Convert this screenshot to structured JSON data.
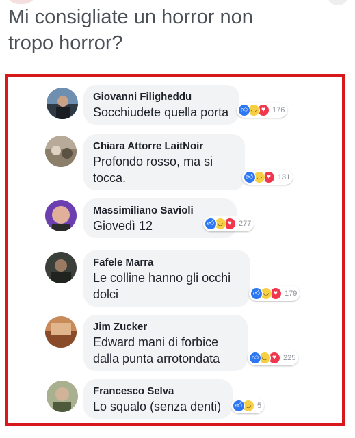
{
  "post": {
    "line1": "Mi consigliate un horror non",
    "line2": "tropo horror?"
  },
  "colors": {
    "highlight_border": "#d7191c",
    "bubble_bg": "#f2f3f5",
    "like": "#2d77f2",
    "haha": "#f7cf45",
    "love": "#f0374e"
  },
  "comments": [
    {
      "author": "Giovanni Filigheddu",
      "lines": [
        "Socchiudete quella porta"
      ],
      "reactions": [
        "like-icon",
        "haha-icon",
        "love-icon"
      ],
      "count": "176"
    },
    {
      "author": "Chiara Attorre LaitNoir",
      "lines": [
        "Profondo rosso, ma si",
        "tocca."
      ],
      "reactions": [
        "like-icon",
        "haha-icon",
        "love-icon"
      ],
      "count": "131"
    },
    {
      "author": "Massimiliano Savioli",
      "lines": [
        "Giovedì 12"
      ],
      "reactions": [
        "like-icon",
        "haha-icon",
        "love-icon"
      ],
      "count": "277"
    },
    {
      "author": "Fafele Marra",
      "lines": [
        "Le colline hanno gli occhi",
        "dolci"
      ],
      "reactions": [
        "like-icon",
        "haha-icon",
        "love-icon"
      ],
      "count": "179"
    },
    {
      "author": "Jim Zucker",
      "lines": [
        "Edward mani di forbice",
        "dalla punta arrotondata"
      ],
      "reactions": [
        "like-icon",
        "haha-icon",
        "love-icon"
      ],
      "count": "225"
    },
    {
      "author": "Francesco Selva",
      "lines": [
        "Lo squalo (senza denti)"
      ],
      "reactions": [
        "like-icon",
        "haha-icon"
      ],
      "count": "5"
    }
  ]
}
